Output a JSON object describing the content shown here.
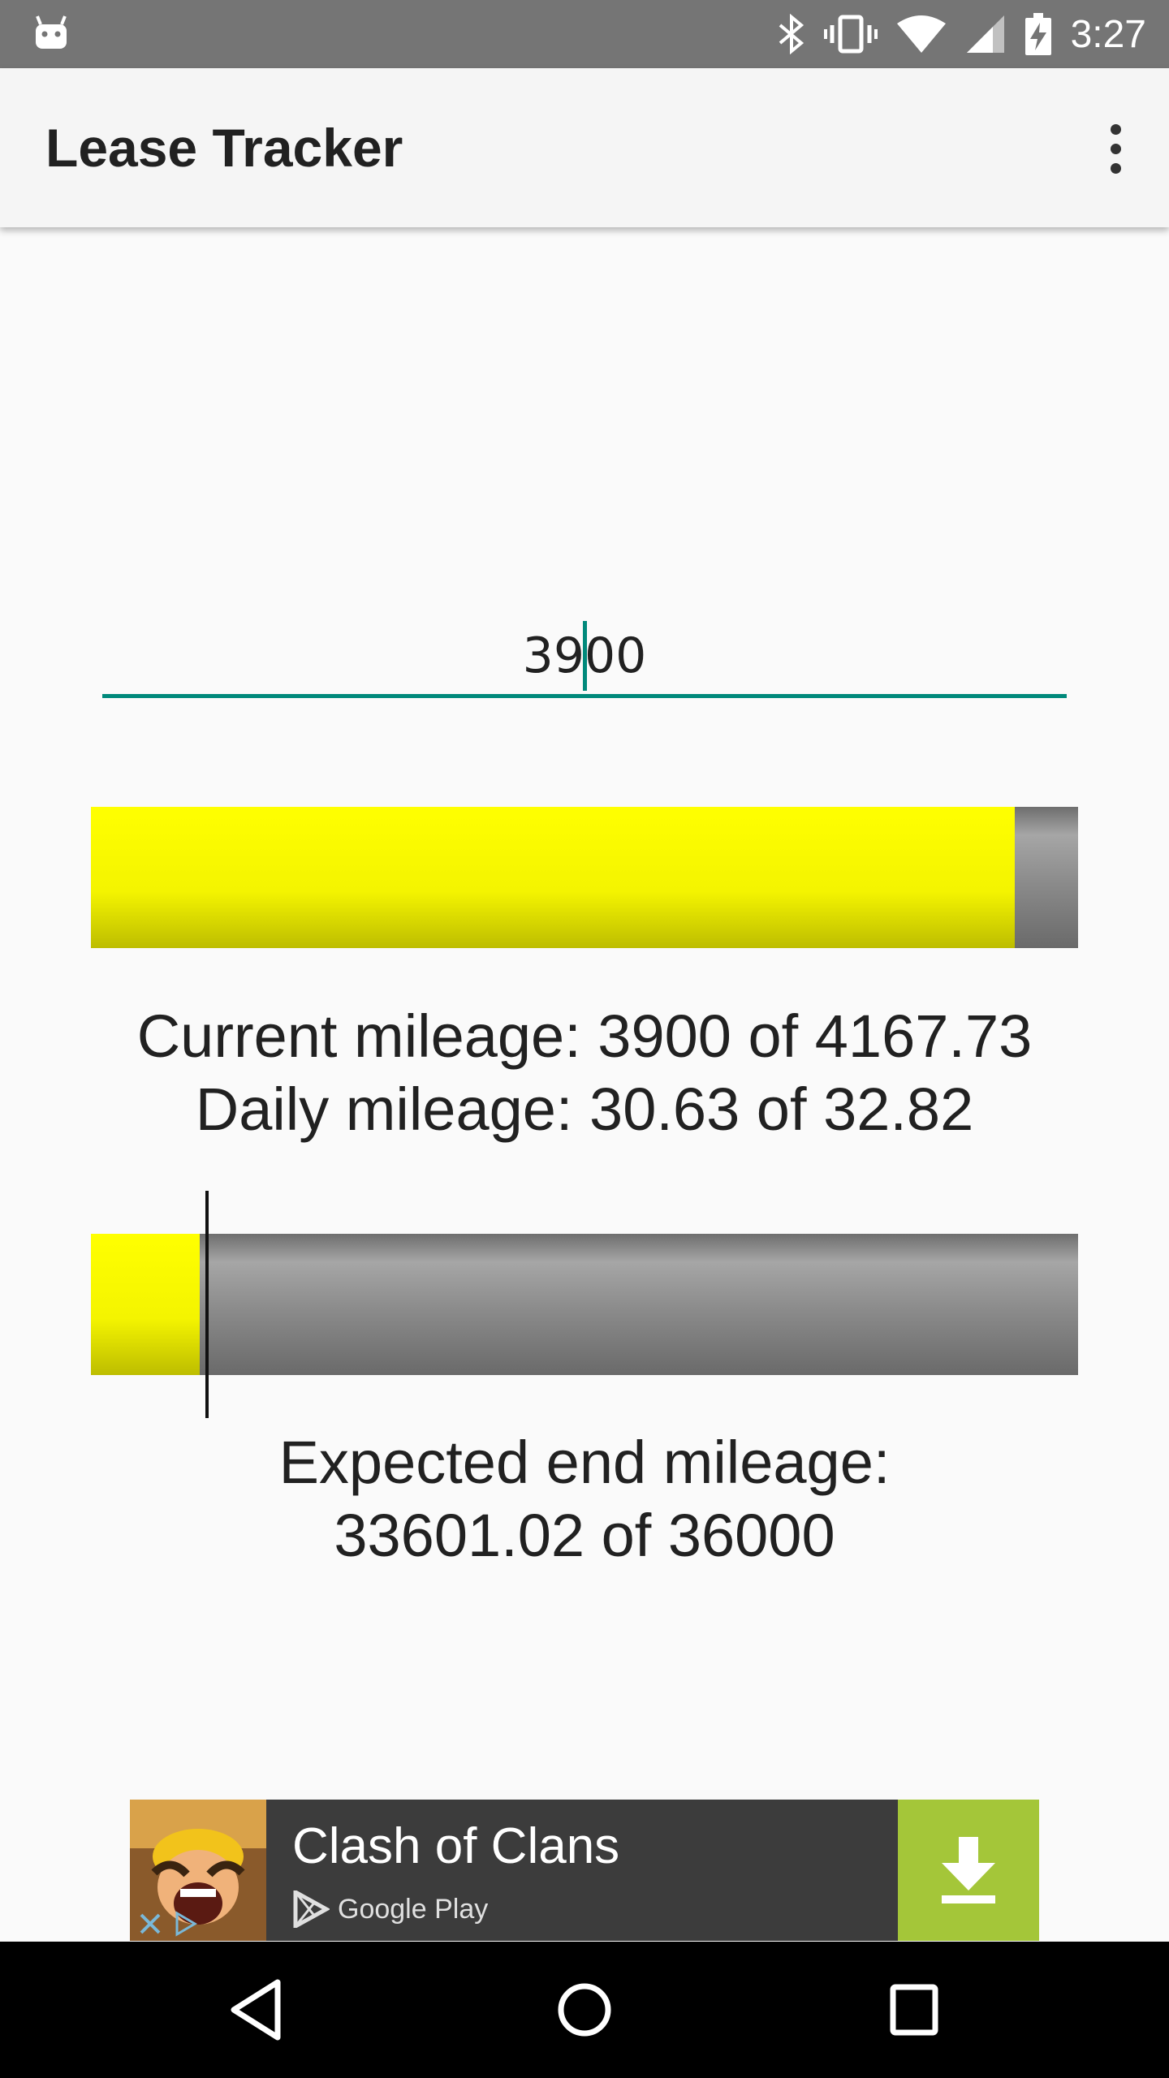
{
  "status_bar": {
    "time": "3:27",
    "icons": [
      "android-notification-icon",
      "bluetooth-icon",
      "vibrate-icon",
      "wifi-icon",
      "signal-icon",
      "battery-charging-icon"
    ]
  },
  "app_bar": {
    "title": "Lease Tracker",
    "overflow_icon": "more-vert-icon"
  },
  "mileage_input": {
    "value": "3900"
  },
  "current_progress": {
    "fraction": 0.936,
    "fill_color": "#ffff00",
    "track_color": "#8a8a8a"
  },
  "summary": {
    "current_mileage": "Current mileage: 3900 of 4167.73",
    "daily_mileage": "Daily mileage: 30.63 of 32.82"
  },
  "lease_progress": {
    "fraction": 0.11,
    "expected_marker_fraction": 0.116,
    "fill_color": "#ffff00"
  },
  "expected": {
    "line1": "Expected end mileage:",
    "line2": "33601.02 of 36000"
  },
  "ad": {
    "title": "Clash of Clans",
    "store": "Google Play",
    "icon": "clash-of-clans-app-icon",
    "button_icon": "download-icon",
    "button_color": "#a4c639"
  },
  "nav_bar": {
    "icons": [
      "back-icon",
      "home-icon",
      "recents-icon"
    ]
  }
}
